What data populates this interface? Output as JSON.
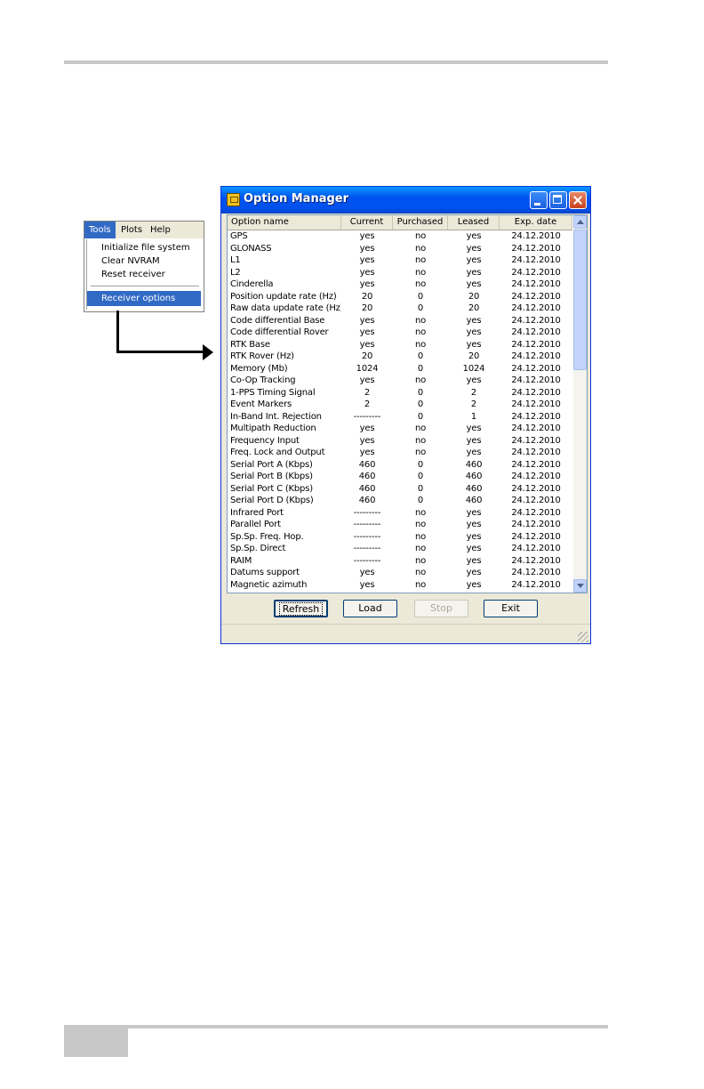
{
  "menu": {
    "bar": [
      "Tools",
      "Plots",
      "Help"
    ],
    "items": [
      "Initialize file system",
      "Clear NVRAM",
      "Reset receiver"
    ],
    "selected_item": "Receiver options"
  },
  "window": {
    "title": "Option Manager",
    "columns": [
      "Option name",
      "Current",
      "Purchased",
      "Leased",
      "Exp. date"
    ],
    "rows": [
      [
        "GPS",
        "yes",
        "no",
        "yes",
        "24.12.2010"
      ],
      [
        "GLONASS",
        "yes",
        "no",
        "yes",
        "24.12.2010"
      ],
      [
        "L1",
        "yes",
        "no",
        "yes",
        "24.12.2010"
      ],
      [
        "L2",
        "yes",
        "no",
        "yes",
        "24.12.2010"
      ],
      [
        "Cinderella",
        "yes",
        "no",
        "yes",
        "24.12.2010"
      ],
      [
        "Position update rate (Hz)",
        "20",
        "0",
        "20",
        "24.12.2010"
      ],
      [
        "Raw data update rate (Hz)",
        "20",
        "0",
        "20",
        "24.12.2010"
      ],
      [
        "Code differential Base",
        "yes",
        "no",
        "yes",
        "24.12.2010"
      ],
      [
        "Code differential Rover",
        "yes",
        "no",
        "yes",
        "24.12.2010"
      ],
      [
        "RTK Base",
        "yes",
        "no",
        "yes",
        "24.12.2010"
      ],
      [
        "RTK Rover (Hz)",
        "20",
        "0",
        "20",
        "24.12.2010"
      ],
      [
        "Memory (Mb)",
        "1024",
        "0",
        "1024",
        "24.12.2010"
      ],
      [
        "Co-Op Tracking",
        "yes",
        "no",
        "yes",
        "24.12.2010"
      ],
      [
        "1-PPS Timing Signal",
        "2",
        "0",
        "2",
        "24.12.2010"
      ],
      [
        "Event Markers",
        "2",
        "0",
        "2",
        "24.12.2010"
      ],
      [
        "In-Band Int. Rejection",
        "---------",
        "0",
        "1",
        "24.12.2010"
      ],
      [
        "Multipath Reduction",
        "yes",
        "no",
        "yes",
        "24.12.2010"
      ],
      [
        "Frequency Input",
        "yes",
        "no",
        "yes",
        "24.12.2010"
      ],
      [
        "Freq. Lock and Output",
        "yes",
        "no",
        "yes",
        "24.12.2010"
      ],
      [
        "Serial Port A (Kbps)",
        "460",
        "0",
        "460",
        "24.12.2010"
      ],
      [
        "Serial Port B (Kbps)",
        "460",
        "0",
        "460",
        "24.12.2010"
      ],
      [
        "Serial Port C (Kbps)",
        "460",
        "0",
        "460",
        "24.12.2010"
      ],
      [
        "Serial Port D (Kbps)",
        "460",
        "0",
        "460",
        "24.12.2010"
      ],
      [
        "Infrared Port",
        "---------",
        "no",
        "yes",
        "24.12.2010"
      ],
      [
        "Parallel Port",
        "---------",
        "no",
        "yes",
        "24.12.2010"
      ],
      [
        "Sp.Sp. Freq. Hop.",
        "---------",
        "no",
        "yes",
        "24.12.2010"
      ],
      [
        "Sp.Sp. Direct",
        "---------",
        "no",
        "yes",
        "24.12.2010"
      ],
      [
        "RAIM",
        "---------",
        "no",
        "yes",
        "24.12.2010"
      ],
      [
        "Datums support",
        "yes",
        "no",
        "yes",
        "24.12.2010"
      ],
      [
        "Magnetic azimuth",
        "yes",
        "no",
        "yes",
        "24.12.2010"
      ]
    ],
    "buttons": {
      "refresh": "Refresh",
      "load": "Load",
      "stop": "Stop",
      "exit": "Exit"
    }
  }
}
